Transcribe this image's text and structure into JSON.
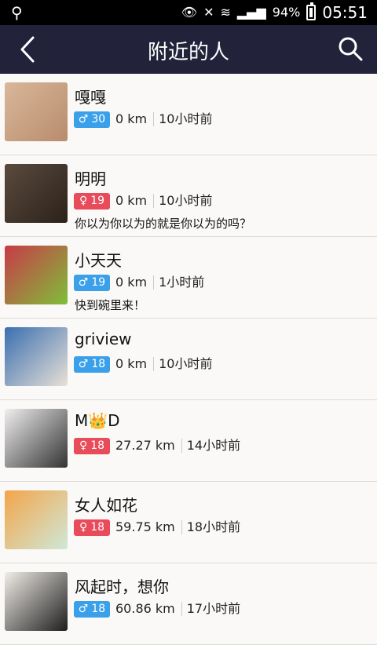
{
  "statusbar": {
    "battery": "94%",
    "time": "05:51"
  },
  "header": {
    "title": "附近的人"
  },
  "people": [
    {
      "name": "嘎嘎",
      "gender": "male",
      "symbol": "♂",
      "age": "30",
      "distance": "0 km",
      "time": "10小时前",
      "signature": "",
      "avatar_colors": [
        "#d9b79a",
        "#b88c6d"
      ]
    },
    {
      "name": "明明",
      "gender": "female",
      "symbol": "♀",
      "age": "19",
      "distance": "0 km",
      "time": "10小时前",
      "signature": "你以为你以为的就是你以为的吗？",
      "avatar_colors": [
        "#5a4a3e",
        "#2c221a"
      ]
    },
    {
      "name": "小天天",
      "gender": "male",
      "symbol": "♂",
      "age": "19",
      "distance": "0 km",
      "time": "1小时前",
      "signature": "快到碗里来！",
      "avatar_colors": [
        "#c83a48",
        "#7fbf3a"
      ]
    },
    {
      "name": "griview",
      "gender": "male",
      "symbol": "♂",
      "age": "18",
      "distance": "0 km",
      "time": "10小时前",
      "signature": "",
      "avatar_colors": [
        "#3a6fb0",
        "#e8e0d6"
      ]
    },
    {
      "name": "M👑D",
      "gender": "female",
      "symbol": "♀",
      "age": "18",
      "distance": "27.27 km",
      "time": "14小时前",
      "signature": "",
      "avatar_colors": [
        "#f0eeee",
        "#333333"
      ]
    },
    {
      "name": "女人如花",
      "gender": "female",
      "symbol": "♀",
      "age": "18",
      "distance": "59.75 km",
      "time": "18小时前",
      "signature": "",
      "avatar_colors": [
        "#f3a54a",
        "#cfe8d8"
      ]
    },
    {
      "name": "风起时，想你",
      "gender": "male",
      "symbol": "♂",
      "age": "18",
      "distance": "60.86 km",
      "time": "17小时前",
      "signature": "",
      "avatar_colors": [
        "#f1ede8",
        "#1e1e1e"
      ]
    }
  ]
}
